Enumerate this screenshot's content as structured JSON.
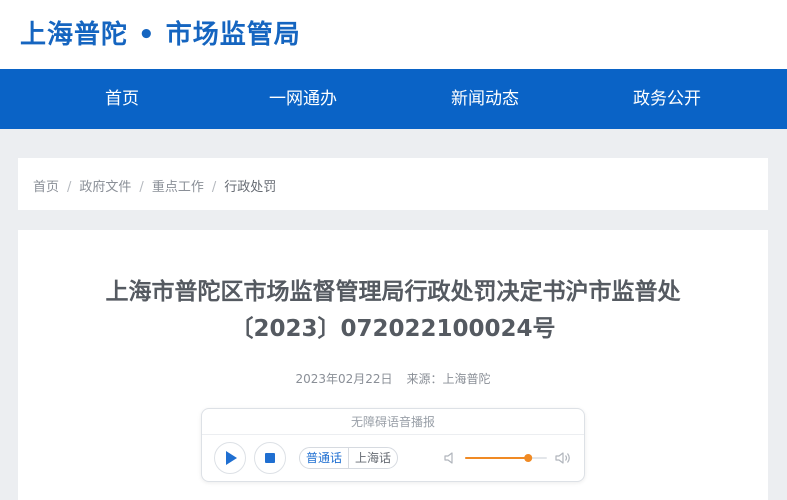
{
  "header": {
    "site_title": "上海普陀 • 市场监管局"
  },
  "nav": {
    "items": [
      {
        "label": "首页"
      },
      {
        "label": "一网通办"
      },
      {
        "label": "新闻动态"
      },
      {
        "label": "政务公开"
      }
    ]
  },
  "breadcrumb": {
    "items": [
      {
        "label": "首页"
      },
      {
        "label": "政府文件"
      },
      {
        "label": "重点工作"
      },
      {
        "label": "行政处罚"
      }
    ],
    "separator": "/"
  },
  "article": {
    "title": "上海市普陀区市场监督管理局行政处罚决定书沪市监普处〔2023〕072022100024号",
    "date": "2023年02月22日",
    "source_label": "来源：",
    "source": "上海普陀"
  },
  "player": {
    "title": "无障碍语音播报",
    "languages": [
      {
        "label": "普通话",
        "active": true
      },
      {
        "label": "上海话",
        "active": false
      }
    ],
    "volume": 0.8,
    "icons": [
      "play-icon",
      "stop-icon",
      "volume-low-icon",
      "volume-high-icon"
    ]
  },
  "colors": {
    "brand_blue": "#0a63c6",
    "title_blue": "#1565c0",
    "slider_orange": "#f08a24",
    "page_bg": "#eceef1"
  }
}
